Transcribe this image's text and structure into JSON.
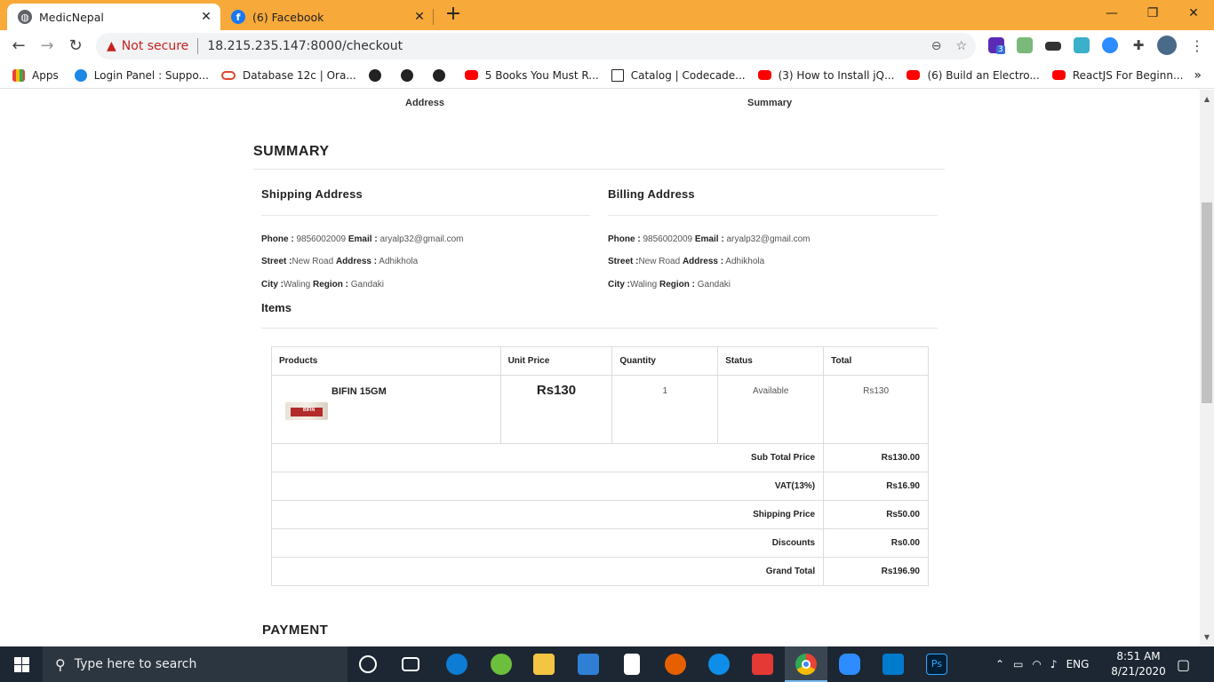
{
  "browser": {
    "tabs": [
      {
        "title": "MedicNepal",
        "active": true,
        "icon": "globe-icon"
      },
      {
        "title": "(6) Facebook",
        "active": false,
        "icon": "facebook-icon"
      }
    ],
    "address": {
      "security": "Not secure",
      "url": "18.215.235.147:8000/checkout"
    },
    "bookmarks": [
      {
        "label": "Apps",
        "icon": "apps-grid-icon"
      },
      {
        "label": "Login Panel : Suppo...",
        "icon": "login-icon"
      },
      {
        "label": "Database 12c | Ora...",
        "icon": "oracle-icon"
      },
      {
        "label": "",
        "icon": "globe-icon"
      },
      {
        "label": "",
        "icon": "globe-icon"
      },
      {
        "label": "",
        "icon": "globe-icon"
      },
      {
        "label": "5 Books You Must R...",
        "icon": "youtube-icon"
      },
      {
        "label": "Catalog | Codecade...",
        "icon": "codecademy-icon"
      },
      {
        "label": "(3) How to Install jQ...",
        "icon": "youtube-icon"
      },
      {
        "label": "(6) Build an Electro...",
        "icon": "youtube-icon"
      },
      {
        "label": "ReactJS For Beginn...",
        "icon": "youtube-icon"
      }
    ],
    "extension_badge": "3"
  },
  "steps": {
    "address": "Address",
    "summary": "Summary"
  },
  "summary": {
    "title": "SUMMARY",
    "shipping": {
      "title": "Shipping Address",
      "phone_label": "Phone :",
      "phone": "9856002009",
      "email_label": "Email :",
      "email": "aryalp32@gmail.com",
      "street_label": "Street :",
      "street": "New Road",
      "address_label": "Address :",
      "address": "Adhikhola",
      "city_label": "City :",
      "city": "Waling",
      "region_label": "Region :",
      "region": "Gandaki"
    },
    "billing": {
      "title": "Billing Address",
      "phone_label": "Phone :",
      "phone": "9856002009",
      "email_label": "Email :",
      "email": "aryalp32@gmail.com",
      "street_label": "Street :",
      "street": "New Road",
      "address_label": "Address :",
      "address": "Adhikhola",
      "city_label": "City :",
      "city": "Waling",
      "region_label": "Region :",
      "region": "Gandaki"
    },
    "items_title": "Items",
    "table": {
      "headers": [
        "Products",
        "Unit Price",
        "Quantity",
        "Status",
        "Total"
      ],
      "rows": [
        {
          "product": "BIFIN 15GM",
          "image_label": "BIFIN",
          "unit_price": "Rs130",
          "quantity": "1",
          "status": "Available",
          "total": "Rs130"
        }
      ],
      "totals": [
        {
          "label": "Sub Total Price",
          "value": "Rs130.00"
        },
        {
          "label": "VAT(13%)",
          "value": "Rs16.90"
        },
        {
          "label": "Shipping Price",
          "value": "Rs50.00"
        },
        {
          "label": "Discounts",
          "value": "Rs0.00"
        },
        {
          "label": "Grand Total",
          "value": "Rs196.90"
        }
      ]
    }
  },
  "payment": {
    "title": "PAYMENT"
  },
  "taskbar": {
    "search_placeholder": "Type here to search",
    "language": "ENG",
    "time": "8:51 AM",
    "date": "8/21/2020"
  }
}
